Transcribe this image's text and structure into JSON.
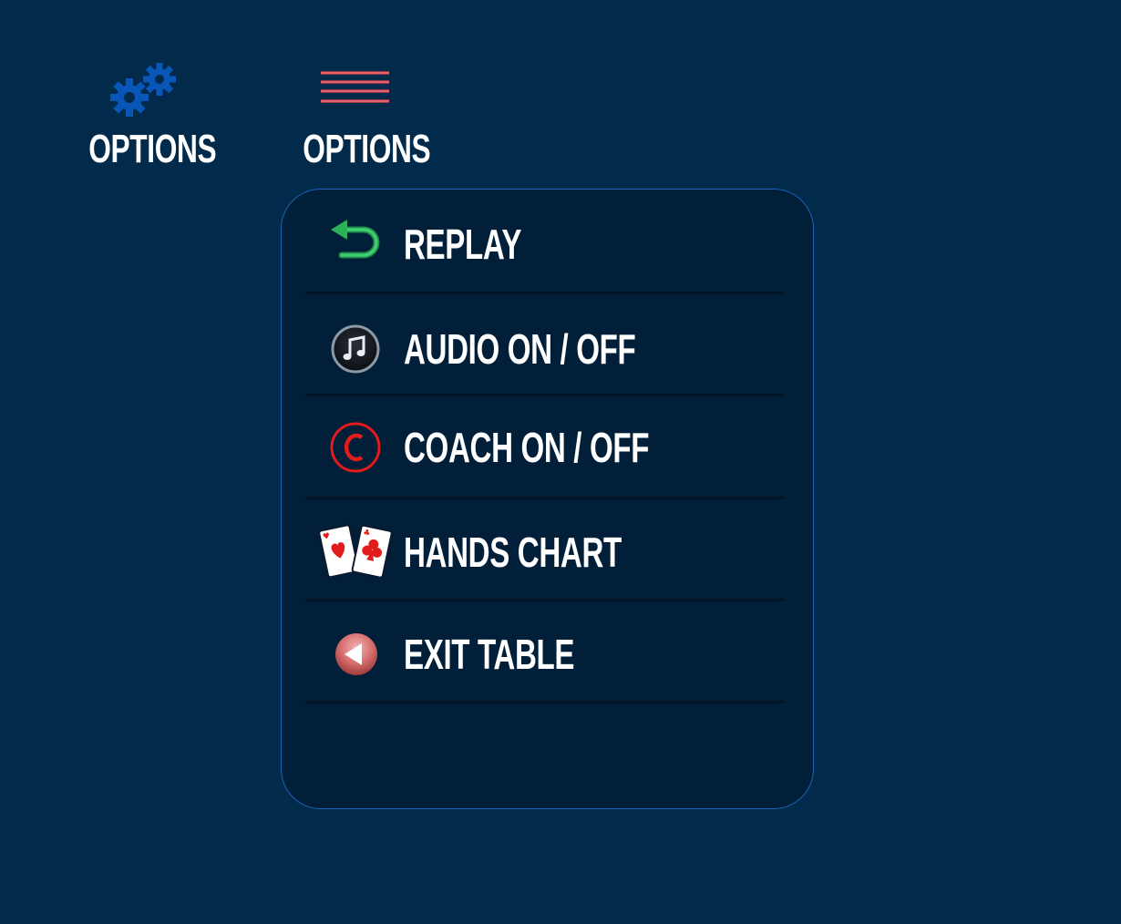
{
  "background_color": "#022a4b",
  "top_buttons": [
    {
      "label": "OPTIONS",
      "icon": "gears-icon"
    },
    {
      "label": "OPTIONS",
      "icon": "hamburger-menu-icon"
    }
  ],
  "menu": {
    "items": [
      {
        "label": "REPLAY",
        "icon": "replay-arrow-icon"
      },
      {
        "label": "AUDIO ON / OFF",
        "icon": "music-note-icon"
      },
      {
        "label": "COACH ON / OFF",
        "icon": "coach-c-icon"
      },
      {
        "label": "HANDS CHART",
        "icon": "playing-cards-icon"
      },
      {
        "label": "EXIT TABLE",
        "icon": "exit-arrow-icon"
      }
    ]
  },
  "colors": {
    "panel_border": "#1a63b8",
    "panel_bg": "#011f38",
    "gear_blue": "#0a56b8",
    "replay_green": "#2bb05a",
    "coach_red": "#e21b1b",
    "exit_pink": "#d46a6a"
  }
}
